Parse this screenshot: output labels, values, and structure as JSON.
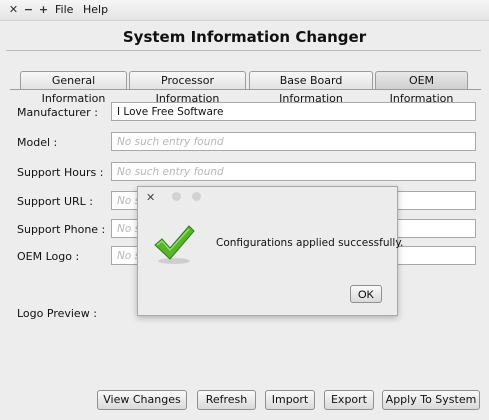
{
  "menubar": {
    "items": [
      "File",
      "Help"
    ]
  },
  "app": {
    "title": "System Information Changer"
  },
  "tabs": [
    {
      "label": "General Information"
    },
    {
      "label": "Processor Information"
    },
    {
      "label": "Base Board Information"
    },
    {
      "label": "OEM Information",
      "active": true
    }
  ],
  "form": {
    "fields": [
      {
        "label": "Manufacturer :",
        "value": "I Love Free Software"
      },
      {
        "label": "Model :",
        "placeholder": "No such entry found"
      },
      {
        "label": "Support Hours :",
        "placeholder": "No such entry found"
      },
      {
        "label": "Support URL :",
        "placeholder": "No s"
      },
      {
        "label": "Support Phone :",
        "placeholder": "No s"
      },
      {
        "label": "OEM Logo :",
        "placeholder": "No s"
      }
    ],
    "logo_preview_label": "Logo Preview :"
  },
  "dialog": {
    "message": "Configurations applied successfully.",
    "ok_label": "OK",
    "icon": "checkmark-icon",
    "accent": "#56b32a"
  },
  "buttons": {
    "view_changes": "View Changes",
    "refresh": "Refresh",
    "import": "Import",
    "export": "Export",
    "apply": "Apply To System"
  }
}
